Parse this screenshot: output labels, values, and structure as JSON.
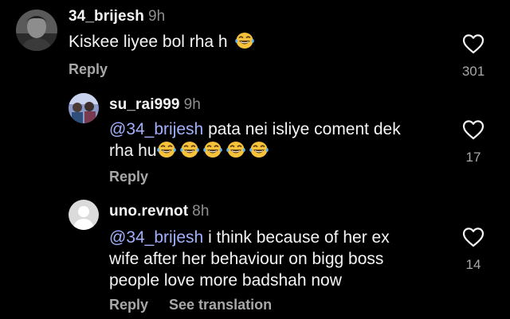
{
  "comments": [
    {
      "username": "34_brijesh",
      "time": "9h",
      "text": "Kiskee liyee bol rha h",
      "emoji_count": 1,
      "likes": "301",
      "actions": [
        "Reply"
      ]
    },
    {
      "username": "su_rai999",
      "time": "9h",
      "mention": "@34_brijesh",
      "text": "pata nei isliye coment dek",
      "text_line2": "rha hu",
      "emoji_count": 5,
      "likes": "17",
      "actions": [
        "Reply"
      ]
    },
    {
      "username": "uno.revnot",
      "time": "8h",
      "mention": "@34_brijesh",
      "text_line1": "i think because of her ex",
      "text_line2": "wife after her behaviour on bigg boss",
      "text_line3": "people love more badshah now",
      "likes": "14",
      "actions": [
        "Reply",
        "See translation"
      ]
    }
  ],
  "icons": {
    "like": "heart-outline-icon",
    "emoji": "face-with-tears-of-joy-emoji",
    "default_avatar": "default-avatar-icon"
  },
  "colors": {
    "background": "#000000",
    "text": "#f5f5f5",
    "secondary": "#a8a8a8",
    "mention": "#a3b0ff"
  }
}
